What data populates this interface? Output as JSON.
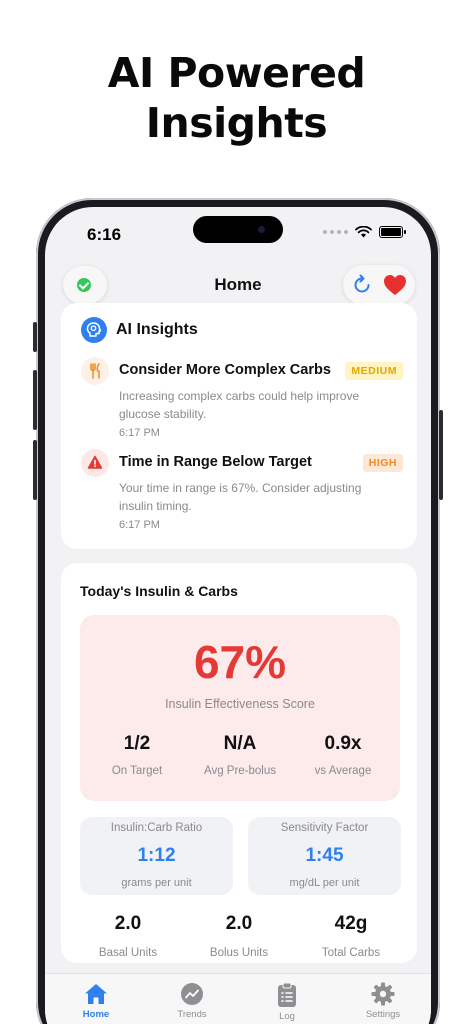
{
  "headline": {
    "line1": "AI Powered",
    "line2": "Insights"
  },
  "status_bar": {
    "time": "6:16"
  },
  "nav": {
    "title": "Home"
  },
  "ai_insights": {
    "title": "AI Insights",
    "items": [
      {
        "title": "Consider More Complex Carbs",
        "badge": "MEDIUM",
        "description": "Increasing complex carbs could help improve glucose stability.",
        "time": "6:17 PM",
        "icon": "fork-knife-icon"
      },
      {
        "title": "Time in Range Below Target",
        "badge": "HIGH",
        "description": "Your time in range is 67%. Consider adjusting insulin timing.",
        "time": "6:17 PM",
        "icon": "warning-icon"
      }
    ]
  },
  "summary": {
    "title": "Today's Insulin & Carbs",
    "score": {
      "value": "67%",
      "label": "Insulin Effectiveness Score"
    },
    "metrics": [
      {
        "value": "1/2",
        "label": "On Target"
      },
      {
        "value": "N/A",
        "label": "Avg Pre-bolus"
      },
      {
        "value": "0.9x",
        "label": "vs Average"
      }
    ],
    "ratio": {
      "header": "Insulin:Carb Ratio",
      "value": "1:12",
      "unit": "grams per unit"
    },
    "sensitivity": {
      "header": "Sensitivity Factor",
      "value": "1:45",
      "unit": "mg/dL per unit"
    },
    "bottom": [
      {
        "value": "2.0",
        "label": "Basal Units"
      },
      {
        "value": "2.0",
        "label": "Bolus Units"
      },
      {
        "value": "42g",
        "label": "Total Carbs"
      }
    ]
  },
  "tabs": [
    {
      "label": "Home",
      "icon": "house-icon",
      "active": true
    },
    {
      "label": "Trends",
      "icon": "chart-icon",
      "active": false
    },
    {
      "label": "Log",
      "icon": "clipboard-icon",
      "active": false
    },
    {
      "label": "Settings",
      "icon": "gear-icon",
      "active": false
    }
  ],
  "colors": {
    "accent": "#2f80ed",
    "danger": "#e53935",
    "success": "#34c759",
    "medium_badge": "#fff4c2",
    "high_badge": "#fde7d6"
  }
}
